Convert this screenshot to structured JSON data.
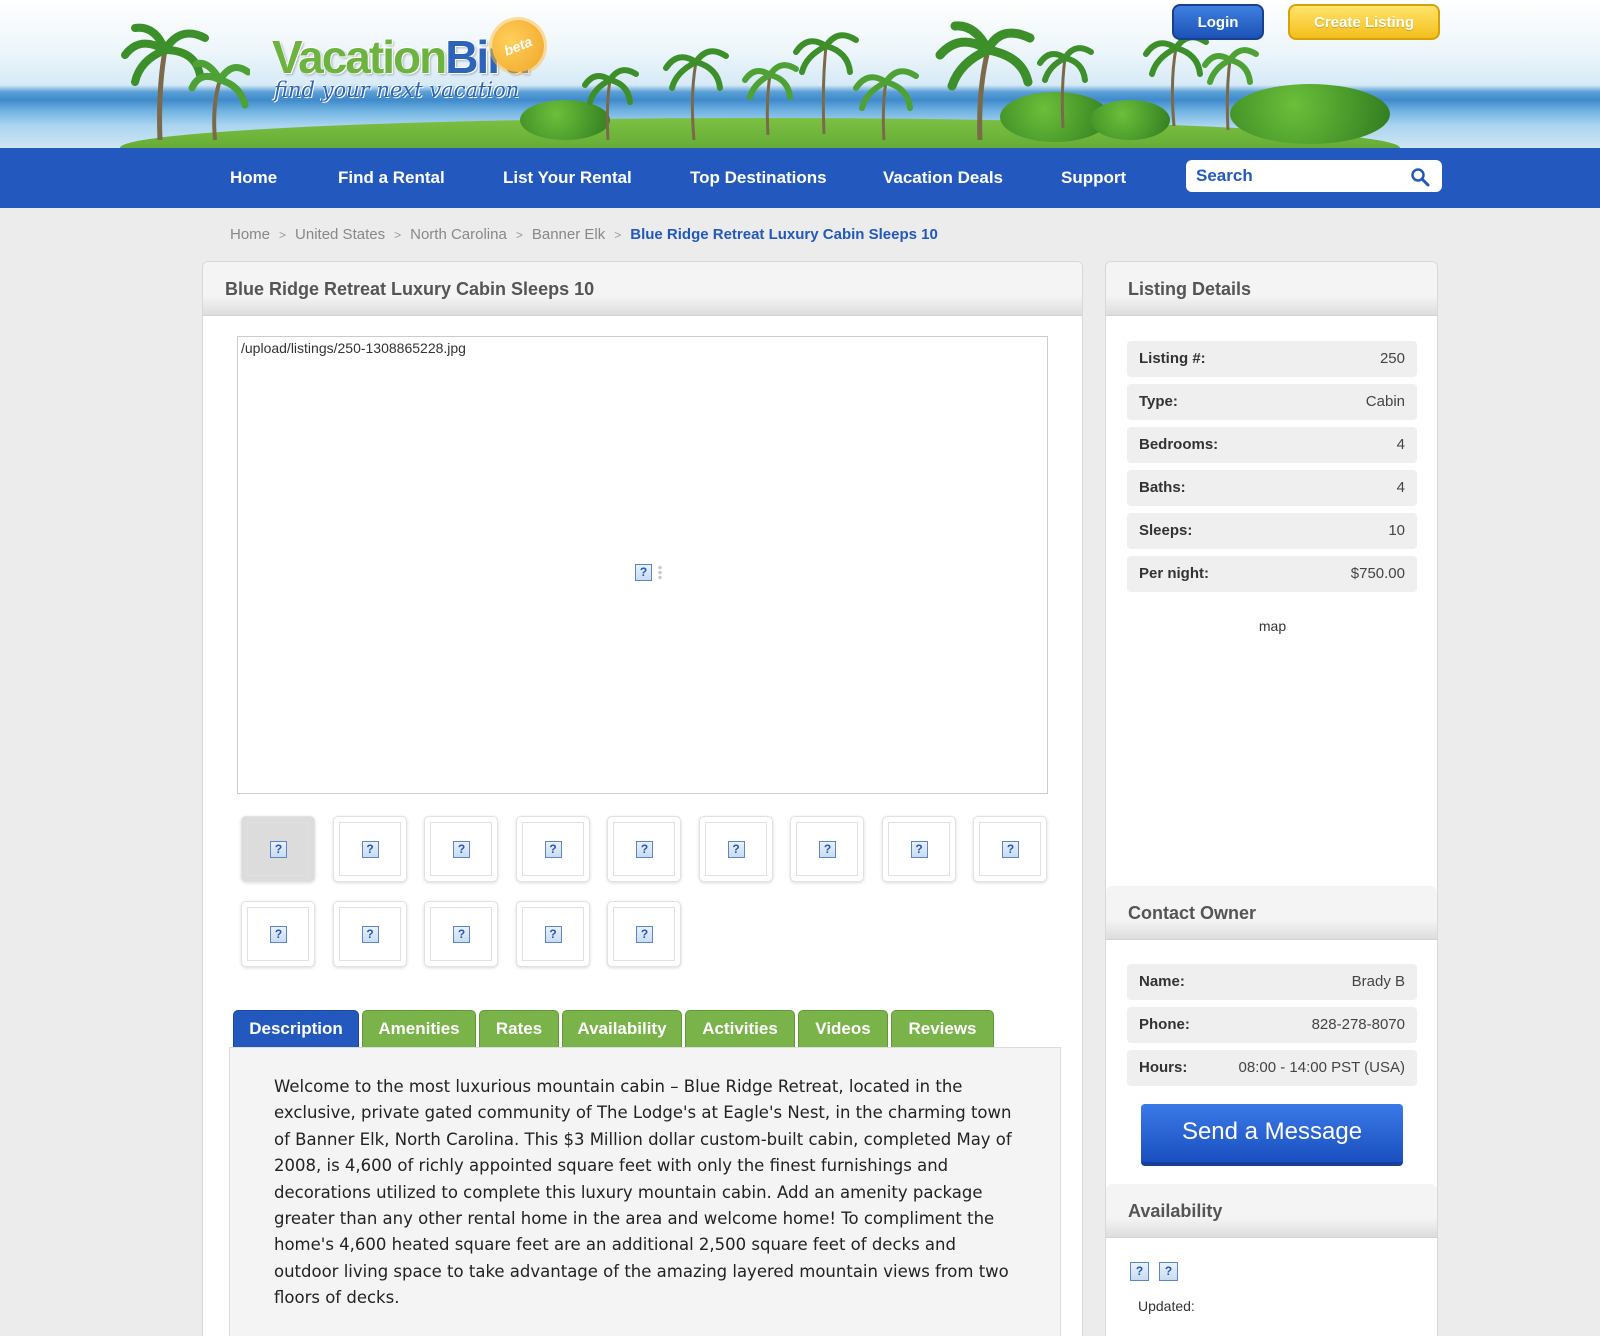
{
  "header": {
    "logo_main_a": "Vacation",
    "logo_main_b": "Bird",
    "logo_tagline": "find your next vacation",
    "beta_badge": "beta",
    "login_label": "Login",
    "create_listing_label": "Create Listing"
  },
  "nav": {
    "items": [
      {
        "label": "Home"
      },
      {
        "label": "Find a Rental"
      },
      {
        "label": "List Your Rental"
      },
      {
        "label": "Top Destinations"
      },
      {
        "label": "Vacation Deals"
      },
      {
        "label": "Support"
      }
    ],
    "search_placeholder": "Search"
  },
  "breadcrumb": {
    "items": [
      "Home",
      "United States",
      "North Carolina",
      "Banner Elk"
    ],
    "separator": ">",
    "current": "Blue Ridge Retreat Luxury Cabin Sleeps 10"
  },
  "listing": {
    "title": "Blue Ridge Retreat Luxury Cabin Sleeps 10",
    "main_image_alt": "/upload/listings/250-1308865228.jpg",
    "broken_image_glyph": "?",
    "thumbnail_count": 14,
    "tabs": [
      "Description",
      "Amenities",
      "Rates",
      "Availability",
      "Activities",
      "Videos",
      "Reviews"
    ],
    "active_tab": "Description",
    "description": "Welcome to the most luxurious mountain cabin – Blue Ridge Retreat, located in the exclusive, private gated community of The Lodge's at Eagle's Nest, in the charming town of Banner Elk, North Carolina. This $3 Million dollar custom-built cabin, completed May of 2008, is 4,600 of richly appointed square feet with only the finest furnishings and decorations utilized to complete this luxury mountain cabin.  Add an amenity package greater than any other rental home in the area and welcome home!  To compliment the home's 4,600 heated square feet are an additional 2,500 square feet of decks and outdoor living space to take advantage of the amazing layered mountain views from two floors of decks."
  },
  "details": {
    "title": "Listing Details",
    "rows": [
      {
        "label": "Listing #:",
        "value": "250"
      },
      {
        "label": "Type:",
        "value": "Cabin"
      },
      {
        "label": "Bedrooms:",
        "value": "4"
      },
      {
        "label": "Baths:",
        "value": "4"
      },
      {
        "label": "Sleeps:",
        "value": "10"
      },
      {
        "label": "Per night:",
        "value": "$750.00"
      }
    ],
    "map_alt": "map"
  },
  "contact": {
    "title": "Contact Owner",
    "rows": [
      {
        "label": "Name:",
        "value": "Brady B"
      },
      {
        "label": "Phone:",
        "value": "828-278-8070"
      },
      {
        "label": "Hours:",
        "value": "08:00 - 14:00 PST (USA)"
      }
    ],
    "send_label": "Send a Message"
  },
  "availability": {
    "title": "Availability",
    "updated_label": "Updated:"
  },
  "colors": {
    "nav_blue": "#2359bf",
    "tab_green": "#7ab34a",
    "create_yellow": "#f4bf1d"
  }
}
